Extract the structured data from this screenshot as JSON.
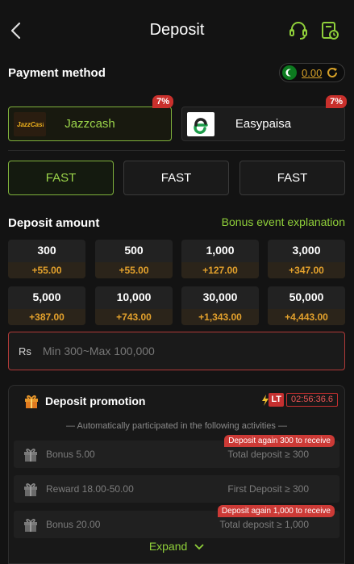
{
  "header": {
    "title": "Deposit",
    "back_icon": "chevron-left-icon",
    "support_icon": "headset-icon",
    "history_icon": "deposit-history-icon"
  },
  "payment": {
    "section_title": "Payment method",
    "balance": "0.00",
    "methods": [
      {
        "name": "Jazzcash",
        "badge": "7%",
        "logo_text": "JazzCash",
        "selected": true
      },
      {
        "name": "Easypaisa",
        "badge": "7%",
        "selected": false
      }
    ],
    "channels": [
      {
        "label": "FAST",
        "selected": true
      },
      {
        "label": "FAST",
        "selected": false
      },
      {
        "label": "FAST",
        "selected": false
      }
    ]
  },
  "deposit": {
    "section_title": "Deposit amount",
    "bonus_link": "Bonus event explanation",
    "amounts": [
      {
        "value": "300",
        "bonus": "+55.00"
      },
      {
        "value": "500",
        "bonus": "+55.00"
      },
      {
        "value": "1,000",
        "bonus": "+127.00"
      },
      {
        "value": "3,000",
        "bonus": "+347.00"
      },
      {
        "value": "5,000",
        "bonus": "+387.00"
      },
      {
        "value": "10,000",
        "bonus": "+743.00"
      },
      {
        "value": "30,000",
        "bonus": "+1,343.00"
      },
      {
        "value": "50,000",
        "bonus": "+4,443.00"
      }
    ],
    "currency": "Rs",
    "input_placeholder": "Min 300~Max 100,000"
  },
  "promotion": {
    "title": "Deposit promotion",
    "lt_label": "LT",
    "timer": "02:56:36.6",
    "auto_note": "— Automatically participated in the following activities —",
    "activities": [
      {
        "label": "Bonus 5.00",
        "condition": "Total deposit ≥ 300",
        "badge": "Deposit again 300 to receive"
      },
      {
        "label": "Reward 18.00-50.00",
        "condition": "First Deposit ≥ 300",
        "badge": ""
      },
      {
        "label": "Bonus 20.00",
        "condition": "Total deposit ≥ 1,000",
        "badge": "Deposit again 1,000 to receive"
      }
    ],
    "expand_label": "Expand"
  },
  "colors": {
    "accent_green": "#8fcf3a",
    "gold": "#e3a12c",
    "red": "#c9302c",
    "background": "#131313"
  }
}
